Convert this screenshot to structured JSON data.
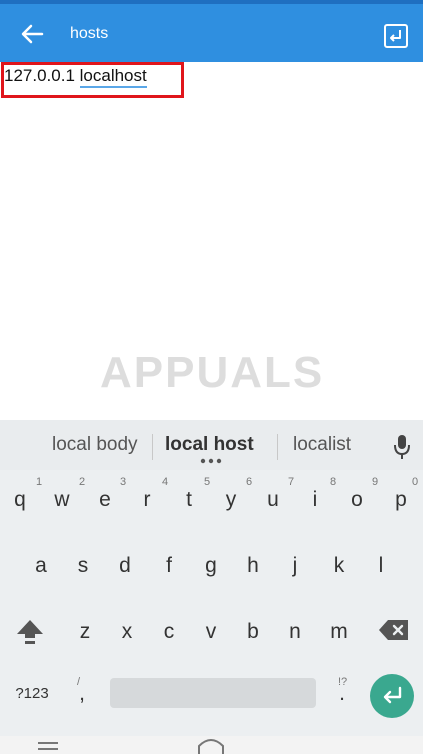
{
  "appbar": {
    "title": "hosts",
    "back_icon": "back-arrow-icon",
    "save_icon": "save-icon"
  },
  "editor": {
    "line_ip": "127.0.0.1",
    "line_host": "localhost"
  },
  "watermark": "APPUALS",
  "keyboard": {
    "suggestions": [
      "local body",
      "local host",
      "localist"
    ],
    "row1": [
      "q",
      "w",
      "e",
      "r",
      "t",
      "y",
      "u",
      "i",
      "o",
      "p"
    ],
    "row1_hints": [
      "1",
      "2",
      "3",
      "4",
      "5",
      "6",
      "7",
      "8",
      "9",
      "0"
    ],
    "row2": [
      "a",
      "s",
      "d",
      "f",
      "g",
      "h",
      "j",
      "k",
      "l"
    ],
    "row3": [
      "z",
      "x",
      "c",
      "v",
      "b",
      "n",
      "m"
    ],
    "symbols_label": "?123",
    "comma": ",",
    "period": ".",
    "comma_hint": "/",
    "period_hint": "!?"
  },
  "colors": {
    "appbar": "#2f8fe0",
    "highlight": "#e0151b",
    "enter": "#3aa88f"
  }
}
